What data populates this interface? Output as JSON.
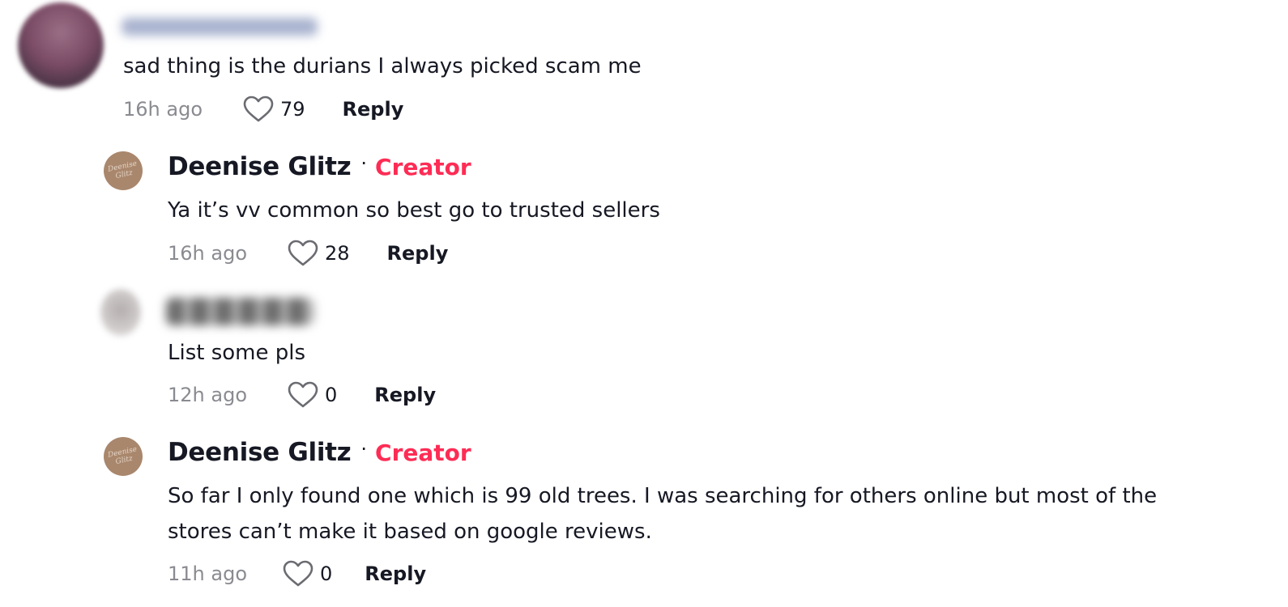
{
  "comments": [
    {
      "text": "sad thing is the durians I always picked scam me",
      "time": "16h ago",
      "likes": "79",
      "reply_label": "Reply"
    },
    {
      "username": "Deenise Glitz",
      "separator": "·",
      "badge": "Creator",
      "text": "Ya it’s vv common so best go to trusted sellers",
      "time": "16h ago",
      "likes": "28",
      "reply_label": "Reply"
    },
    {
      "text": "List some pls",
      "time": "12h ago",
      "likes": "0",
      "reply_label": "Reply"
    },
    {
      "username": "Deenise Glitz",
      "separator": "·",
      "badge": "Creator",
      "text_line1": "So far I only found one which is 99 old trees. I was searching for others online but most of the",
      "text_line2": "stores can’t make it based on google reviews.",
      "time": "11h ago",
      "likes": "0",
      "reply_label": "Reply"
    }
  ],
  "icons": {
    "heart": "heart-outline-icon"
  },
  "colors": {
    "creator_badge": "#fe2c55",
    "text": "#161823",
    "muted": "#8a8b91"
  }
}
